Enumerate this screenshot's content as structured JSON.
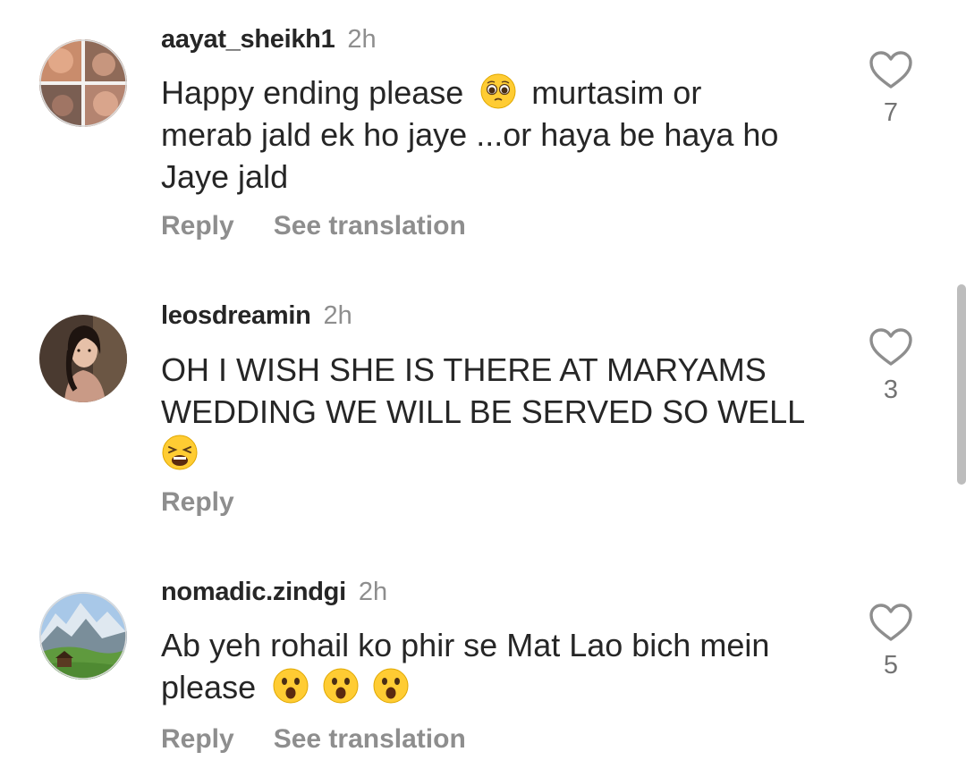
{
  "comments": [
    {
      "username": "aayat_sheikh1",
      "time": "2h",
      "lines": [
        "Happy ending please",
        "murtasim or",
        "merab jald ek ho jaye ...or haya be haya ho",
        "Jaye jald"
      ],
      "emojis": [
        "pleading-face"
      ],
      "reply_label": "Reply",
      "translate_label": "See translation",
      "likes": "7",
      "avatar_icon": "collage-avatar-icon"
    },
    {
      "username": "leosdreamin",
      "time": "2h",
      "lines": [
        "OH I WISH SHE IS THERE AT MARYAMS",
        "WEDDING WE WILL BE SERVED SO WELL"
      ],
      "emojis": [
        "weary-face"
      ],
      "reply_label": "Reply",
      "likes": "3",
      "avatar_icon": "portrait-avatar-icon"
    },
    {
      "username": "nomadic.zindgi",
      "time": "2h",
      "lines": [
        "Ab yeh rohail ko phir se Mat Lao bich mein",
        "please"
      ],
      "emojis": [
        "astonished-face",
        "astonished-face",
        "astonished-face"
      ],
      "reply_label": "Reply",
      "translate_label": "See translation",
      "likes": "5",
      "avatar_icon": "mountain-avatar-icon"
    }
  ],
  "colors": {
    "text": "#262626",
    "muted": "#8e8e8e",
    "emoji_yellow": "#ffcc33"
  }
}
